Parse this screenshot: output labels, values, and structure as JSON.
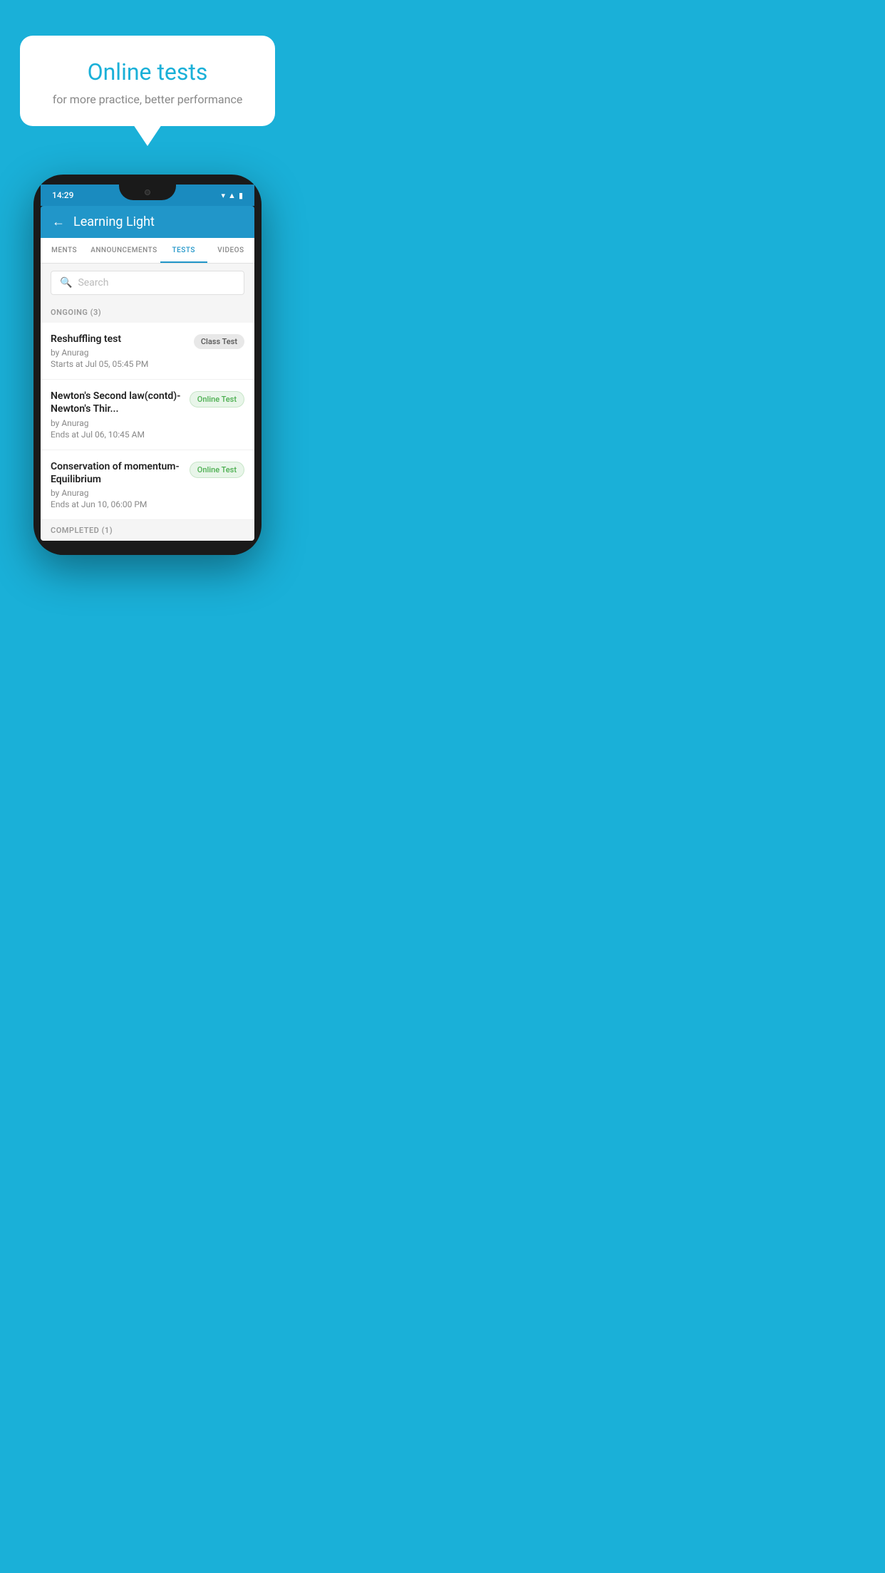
{
  "background_color": "#1ab0d8",
  "hero": {
    "bubble_title": "Online tests",
    "bubble_subtitle": "for more practice, better performance"
  },
  "phone": {
    "status_bar": {
      "time": "14:29",
      "signal_icon": "▲",
      "battery_icon": "▮"
    },
    "app_header": {
      "back_label": "←",
      "title": "Learning Light"
    },
    "tabs": [
      {
        "label": "MENTS",
        "active": false
      },
      {
        "label": "ANNOUNCEMENTS",
        "active": false
      },
      {
        "label": "TESTS",
        "active": true
      },
      {
        "label": "VIDEOS",
        "active": false
      }
    ],
    "search": {
      "placeholder": "Search",
      "icon": "🔍"
    },
    "ongoing_section": {
      "label": "ONGOING (3)",
      "tests": [
        {
          "title": "Reshuffling test",
          "author": "by Anurag",
          "date_label": "Starts at",
          "date": "Jul 05, 05:45 PM",
          "badge": "Class Test",
          "badge_type": "class"
        },
        {
          "title": "Newton's Second law(contd)-Newton's Thir...",
          "author": "by Anurag",
          "date_label": "Ends at",
          "date": "Jul 06, 10:45 AM",
          "badge": "Online Test",
          "badge_type": "online"
        },
        {
          "title": "Conservation of momentum-Equilibrium",
          "author": "by Anurag",
          "date_label": "Ends at",
          "date": "Jun 10, 06:00 PM",
          "badge": "Online Test",
          "badge_type": "online"
        }
      ]
    },
    "completed_section": {
      "label": "COMPLETED (1)"
    }
  }
}
